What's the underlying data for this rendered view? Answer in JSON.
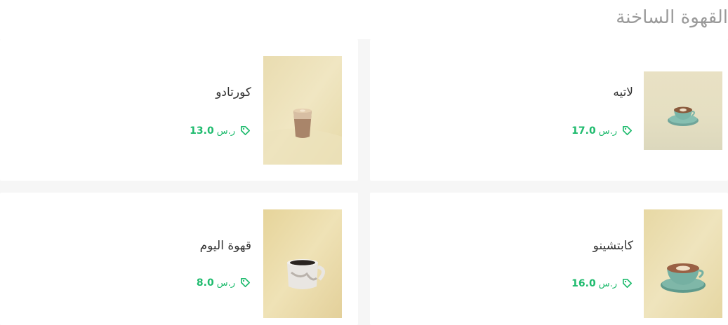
{
  "section": {
    "title": "القهوة الساخنة"
  },
  "currency": "ر.س",
  "products": [
    {
      "name": "لاتيه",
      "price": "17.0",
      "art": "latte"
    },
    {
      "name": "كورتادو",
      "price": "13.0",
      "art": "cortado"
    },
    {
      "name": "كابتشينو",
      "price": "16.0",
      "art": "cappuccino"
    },
    {
      "name": "قهوة اليوم",
      "price": "8.0",
      "art": "coffee-of-the-day"
    }
  ],
  "colors": {
    "accent": "#1fbb6e",
    "title": "#9a9a9a",
    "background": "#f6f6f6",
    "card": "#ffffff"
  },
  "icons": {
    "price": "price-tag-icon"
  }
}
